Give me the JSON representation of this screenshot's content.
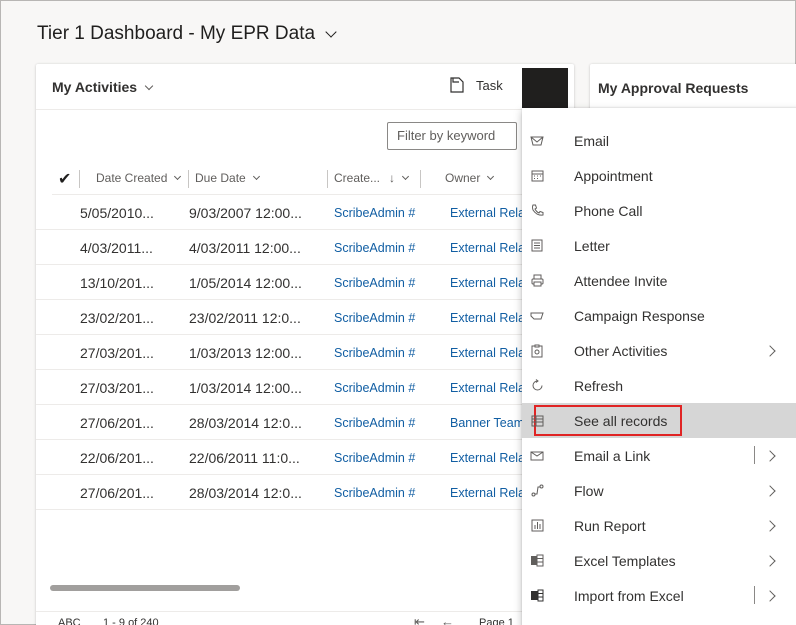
{
  "dashboard": {
    "title": "Tier 1 Dashboard - My EPR Data"
  },
  "activities": {
    "title": "My Activities",
    "task_label": "Task",
    "filter_placeholder": "Filter by keyword",
    "columns": {
      "date_created": "Date Created",
      "due_date": "Due Date",
      "created_by": "Create...",
      "sort_icon": "↓",
      "owner": "Owner"
    },
    "rows": [
      {
        "created": "5/05/2010...",
        "due": "9/03/2007 12:00...",
        "created_by": "ScribeAdmin #",
        "owner": "External Relati"
      },
      {
        "created": "4/03/2011...",
        "due": "4/03/2011 12:00...",
        "created_by": "ScribeAdmin #",
        "owner": "External Relati"
      },
      {
        "created": "13/10/201...",
        "due": "1/05/2014 12:00...",
        "created_by": "ScribeAdmin #",
        "owner": "External Relati"
      },
      {
        "created": "23/02/201...",
        "due": "23/02/2011 12:0...",
        "created_by": "ScribeAdmin #",
        "owner": "External Relati"
      },
      {
        "created": "27/03/201...",
        "due": "1/03/2013 12:00...",
        "created_by": "ScribeAdmin #",
        "owner": "External Relati"
      },
      {
        "created": "27/03/201...",
        "due": "1/03/2014 12:00...",
        "created_by": "ScribeAdmin #",
        "owner": "External Relati"
      },
      {
        "created": "27/06/201...",
        "due": "28/03/2014 12:0...",
        "created_by": "ScribeAdmin #",
        "owner": "Banner Team"
      },
      {
        "created": "22/06/201...",
        "due": "22/06/2011 11:0...",
        "created_by": "ScribeAdmin #",
        "owner": "External Relati"
      },
      {
        "created": "27/06/201...",
        "due": "28/03/2014 12:0...",
        "created_by": "ScribeAdmin #",
        "owner": "External Relati"
      }
    ],
    "footer": {
      "abc": "ABC",
      "count": "1 - 9 of 240",
      "page": "Page 1"
    }
  },
  "approvals": {
    "title": "My Approval Requests"
  },
  "menu": {
    "items": [
      {
        "label": "Email",
        "icon": "email-icon",
        "submenu": false,
        "split": false
      },
      {
        "label": "Appointment",
        "icon": "calendar-icon",
        "submenu": false,
        "split": false
      },
      {
        "label": "Phone Call",
        "icon": "phone-icon",
        "submenu": false,
        "split": false
      },
      {
        "label": "Letter",
        "icon": "letter-icon",
        "submenu": false,
        "split": false
      },
      {
        "label": "Attendee Invite",
        "icon": "printer-icon",
        "submenu": false,
        "split": false
      },
      {
        "label": "Campaign Response",
        "icon": "campaign-icon",
        "submenu": false,
        "split": false
      },
      {
        "label": "Other Activities",
        "icon": "activities-icon",
        "submenu": true,
        "split": false
      },
      {
        "label": "Refresh",
        "icon": "refresh-icon",
        "submenu": false,
        "split": false
      },
      {
        "label": "See all records",
        "icon": "grid-icon",
        "submenu": false,
        "split": false,
        "highlighted": true
      },
      {
        "label": "Email a Link",
        "icon": "email-link-icon",
        "submenu": true,
        "split": true
      },
      {
        "label": "Flow",
        "icon": "flow-icon",
        "submenu": true,
        "split": false
      },
      {
        "label": "Run Report",
        "icon": "report-icon",
        "submenu": true,
        "split": false
      },
      {
        "label": "Excel Templates",
        "icon": "excel-template-icon",
        "submenu": true,
        "split": false
      },
      {
        "label": "Import from Excel",
        "icon": "excel-import-icon",
        "submenu": true,
        "split": true
      }
    ]
  },
  "colors": {
    "link": "#115ea3",
    "highlight_border": "#e02424",
    "active_bg": "#d6d6d6",
    "more_button_bg": "#201f1e"
  }
}
